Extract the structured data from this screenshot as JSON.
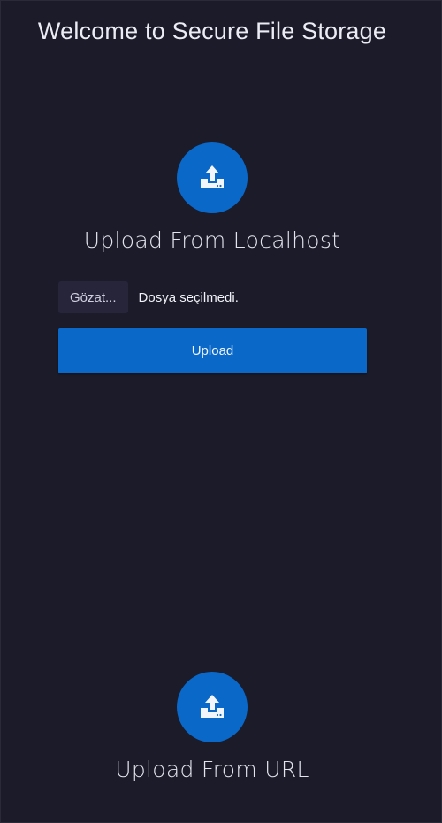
{
  "page": {
    "title": "Welcome to Secure File Storage"
  },
  "colors": {
    "background": "#1b1b29",
    "accent": "#0a68c9",
    "browse_bg": "#26253a"
  },
  "local_upload": {
    "icon": "upload-icon",
    "title": "Upload From Localhost",
    "browse_label": "Gözat...",
    "file_status": "Dosya seçilmedi.",
    "upload_label": "Upload"
  },
  "url_upload": {
    "icon": "upload-icon",
    "title": "Upload From URL"
  }
}
